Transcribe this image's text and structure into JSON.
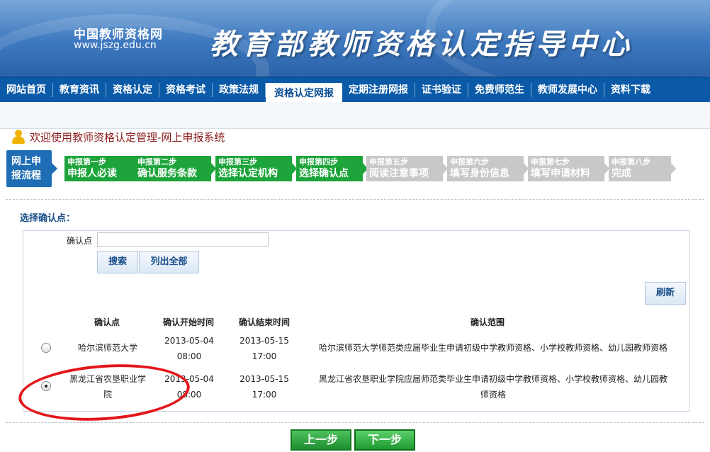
{
  "header": {
    "logo_name": "中国教师资格网",
    "logo_url": "www.jszg.edu.cn",
    "title": "教育部教师资格认定指导中心"
  },
  "nav": {
    "items": [
      {
        "label": "网站首页"
      },
      {
        "label": "教育资讯"
      },
      {
        "label": "资格认定"
      },
      {
        "label": "资格考试"
      },
      {
        "label": "政策法规"
      },
      {
        "label": "资格认定网报",
        "active": true
      },
      {
        "label": "定期注册网报"
      },
      {
        "label": "证书验证"
      },
      {
        "label": "免费师范生"
      },
      {
        "label": "教师发展中心"
      },
      {
        "label": "资料下载"
      }
    ]
  },
  "welcome": "欢迎使用教师资格认定管理-网上申报系统",
  "flow": {
    "label_line1": "网上申",
    "label_line2": "报流程",
    "steps": [
      {
        "num": "申报第一步",
        "name": "申报人必读",
        "status": "done"
      },
      {
        "num": "申报第二步",
        "name": "确认服务条款",
        "status": "done"
      },
      {
        "num": "申报第三步",
        "name": "选择认定机构",
        "status": "done"
      },
      {
        "num": "申报第四步",
        "name": "选择确认点",
        "status": "done"
      },
      {
        "num": "申报第五步",
        "name": "阅读注意事项",
        "status": "todo"
      },
      {
        "num": "申报第六步",
        "name": "填写身份信息",
        "status": "todo"
      },
      {
        "num": "申报第七步",
        "name": "填写申请材料",
        "status": "todo"
      },
      {
        "num": "申报第八步",
        "name": "完成",
        "status": "todo"
      }
    ]
  },
  "section_title": "选择确认点：",
  "search": {
    "label": "确认点",
    "value": "",
    "search_button": "搜索",
    "list_all_button": "列出全部",
    "refresh_button": "刷新"
  },
  "table": {
    "headers": [
      "确认点",
      "确认开始时间",
      "确认结束时间",
      "确认范围"
    ],
    "rows": [
      {
        "selected": false,
        "name": "哈尔滨师范大学",
        "start_date": "2013-05-04",
        "start_time": "08:00",
        "end_date": "2013-05-15",
        "end_time": "17:00",
        "scope": "哈尔滨师范大学师范类应届毕业生申请初级中学教师资格、小学校教师资格、幼儿园教师资格"
      },
      {
        "selected": true,
        "name_line1": "黑龙江省农垦职业学",
        "name_line2": "院",
        "start_date": "2013-05-04",
        "start_time": "08:00",
        "end_date": "2013-05-15",
        "end_time": "17:00",
        "scope_line1": "黑龙江省农垦职业学院应届师范类毕业生申请初级中学教师资格、小学校教师资格、幼儿园教",
        "scope_line2": "师资格"
      }
    ]
  },
  "buttons": {
    "prev": "上一步",
    "next": "下一步"
  },
  "colors": {
    "nav_bg": "#0a5aa8",
    "step_done": "#1da43a",
    "step_todo": "#c8c8c8",
    "welcome_text": "#8a1c1c",
    "annotation": "#e4161b"
  }
}
